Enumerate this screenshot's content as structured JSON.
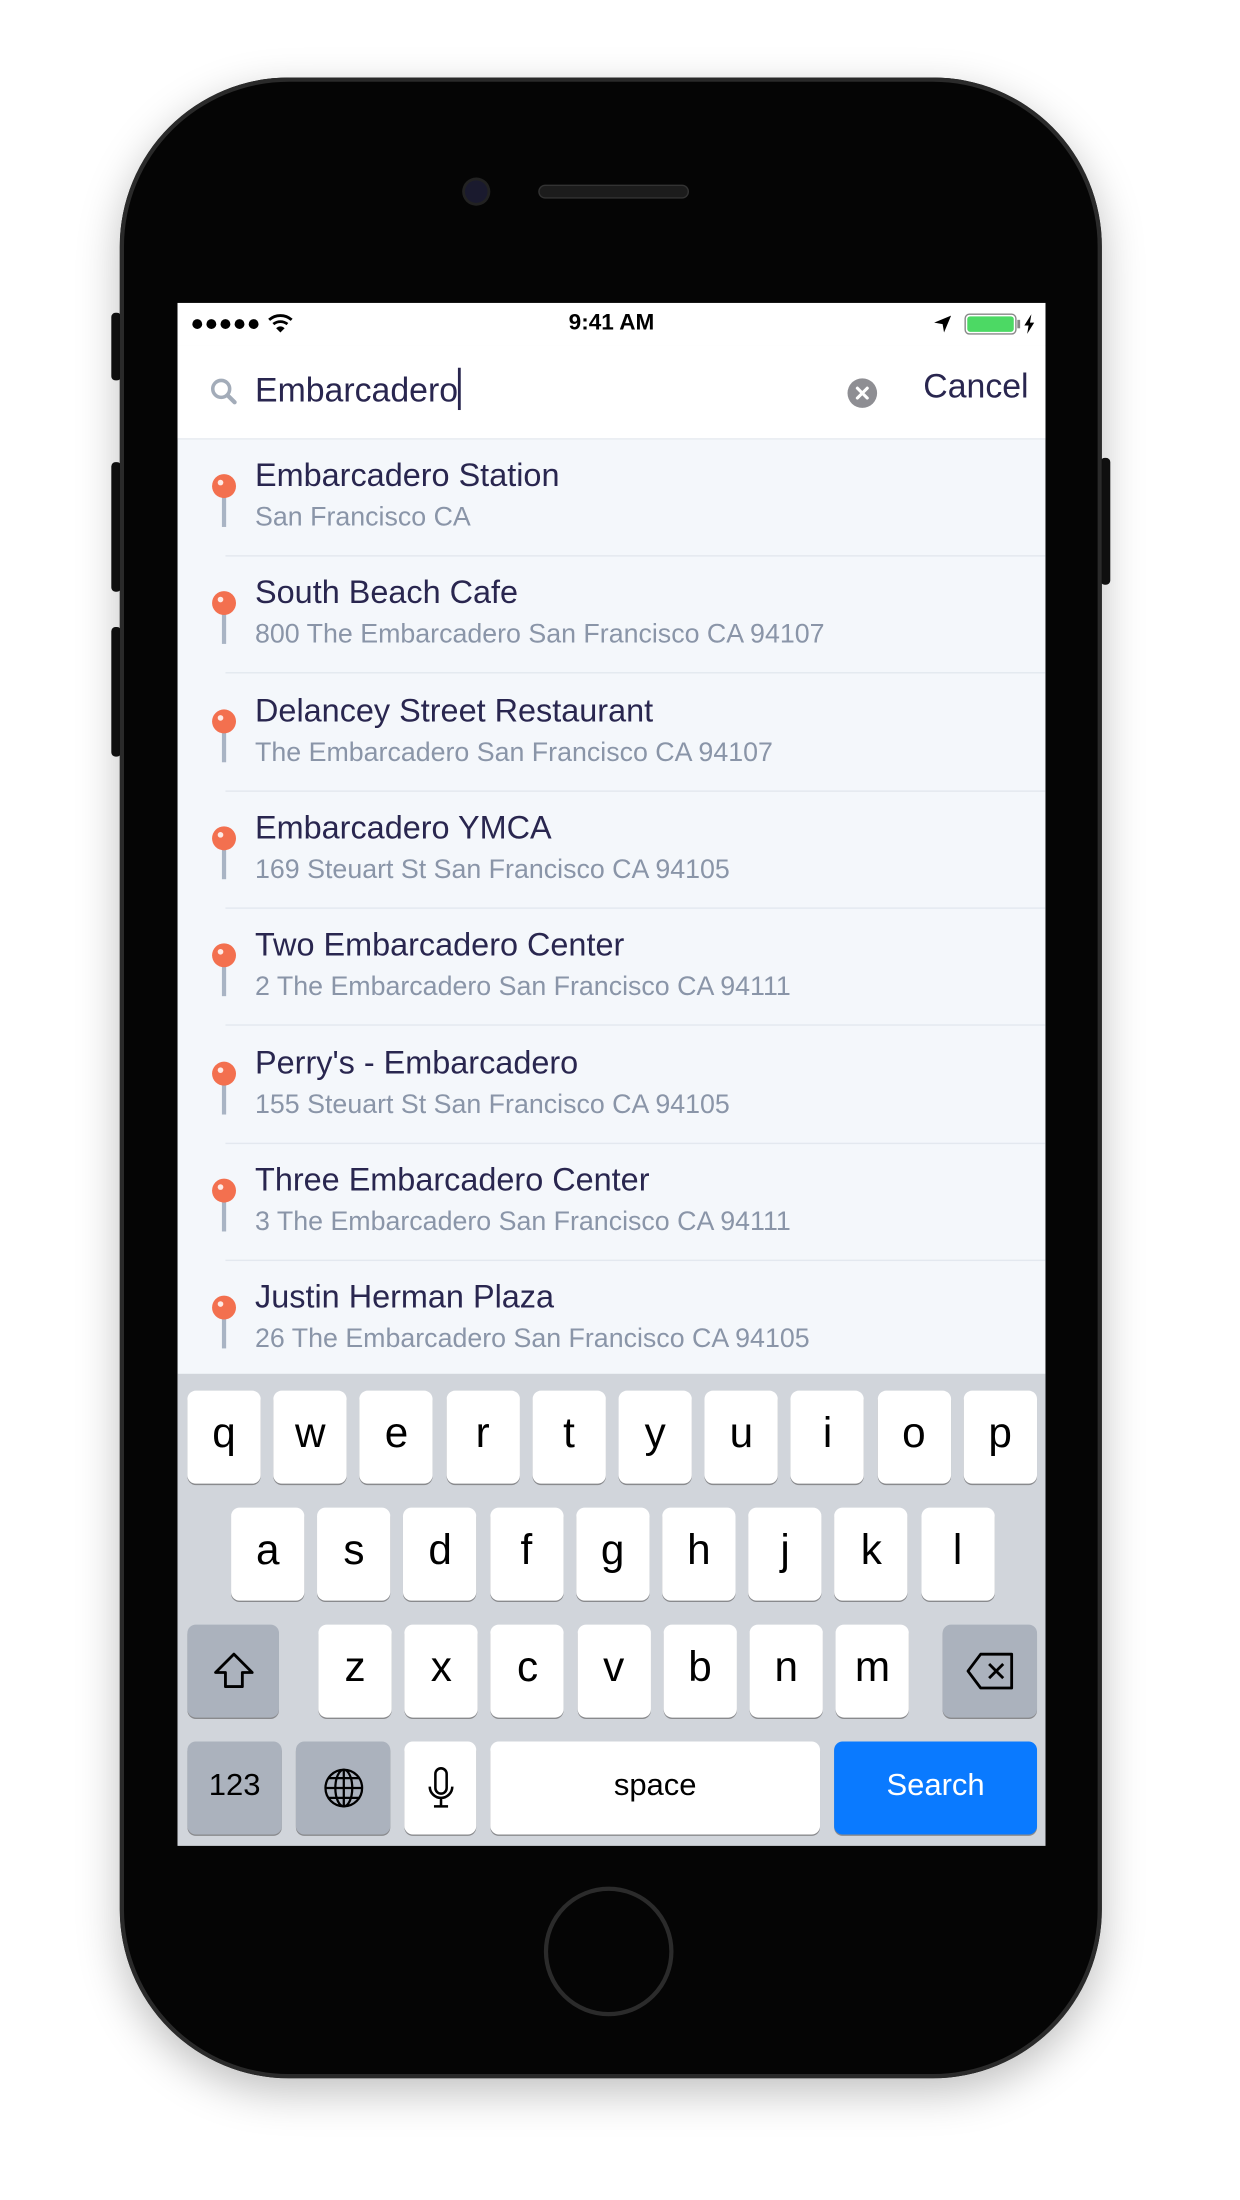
{
  "status_bar": {
    "time": "9:41 AM",
    "signal_icon": "signal-dots-icon",
    "wifi_icon": "wifi-icon",
    "location_icon": "location-arrow-icon",
    "battery_icon": "battery-charging-icon",
    "battery_color": "#4cd964"
  },
  "search": {
    "query": "Embarcadero",
    "cancel_label": "Cancel",
    "search_icon": "search-icon",
    "clear_icon": "clear-icon"
  },
  "results": [
    {
      "title": "Embarcadero Station",
      "subtitle": "San Francisco CA"
    },
    {
      "title": "South Beach Cafe",
      "subtitle": "800 The Embarcadero San Francisco CA 94107"
    },
    {
      "title": "Delancey Street Restaurant",
      "subtitle": "The Embarcadero San Francisco CA 94107"
    },
    {
      "title": "Embarcadero YMCA",
      "subtitle": "169 Steuart St San Francisco CA 94105"
    },
    {
      "title": "Two Embarcadero Center",
      "subtitle": "2 The Embarcadero San Francisco CA 94111"
    },
    {
      "title": "Perry's - Embarcadero",
      "subtitle": "155 Steuart St San Francisco CA 94105"
    },
    {
      "title": "Three Embarcadero Center",
      "subtitle": "3 The Embarcadero San Francisco CA 94111"
    },
    {
      "title": "Justin Herman Plaza",
      "subtitle": "26 The Embarcadero San Francisco CA 94105"
    }
  ],
  "colors": {
    "pin": "#f3704f",
    "title": "#29264f",
    "subtitle": "#8a95a8",
    "accent": "#0a7aff"
  },
  "keyboard": {
    "row1": [
      "q",
      "w",
      "e",
      "r",
      "t",
      "y",
      "u",
      "i",
      "o",
      "p"
    ],
    "row2": [
      "a",
      "s",
      "d",
      "f",
      "g",
      "h",
      "j",
      "k",
      "l"
    ],
    "row3": [
      "z",
      "x",
      "c",
      "v",
      "b",
      "n",
      "m"
    ],
    "numbers_label": "123",
    "space_label": "space",
    "search_label": "Search"
  }
}
